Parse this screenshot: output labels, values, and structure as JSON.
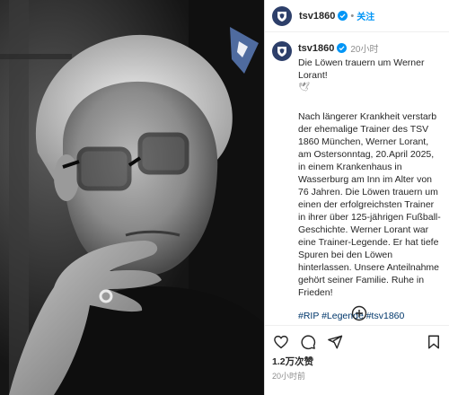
{
  "post": {
    "account": "tsv1860",
    "follow_label": "关注",
    "dot": "•",
    "time_ago": "20小时",
    "title": "Die Löwen trauern um Werner Lorant!",
    "dove": "🕊",
    "body": "Nach längerer Krankheit verstarb der ehemalige Trainer des TSV 1860 München, Werner Lorant, am Ostersonntag, 20.April 2025, in einem Krankenhaus in Wasserburg am Inn im Alter von 76 Jahren. Die Löwen trauern um einen der erfolgreichsten Trainer in ihrer über 125-jährigen Fußball-Geschichte. Werner Lorant war eine Trainer-Legende. Er hat tiefe Spuren bei den Löwen hinterlassen. Unsere Anteilnahme gehört seiner Familie. Ruhe in Frieden!",
    "hashtags": [
      "#RIP",
      "#Legende",
      "#tsv1860"
    ],
    "likes": "1.2万次赞",
    "posted_time": "20小时前"
  },
  "icons": {
    "heart": "heart-icon",
    "comment": "comment-icon",
    "share": "share-icon",
    "save": "bookmark-icon",
    "more_comments": "plus-circle-icon",
    "verified": "verified-badge-icon",
    "club_logo": "lion-crest-icon"
  },
  "colors": {
    "link": "#0095f6",
    "hashtag": "#00376b",
    "verified": "#0095f6",
    "club_blue": "#2d3f6a",
    "muted": "#8e8e8e"
  }
}
